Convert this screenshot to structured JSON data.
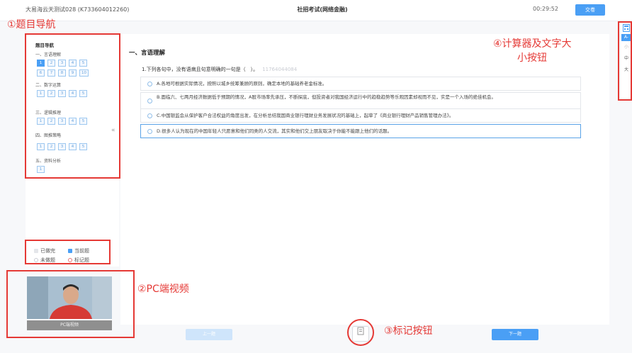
{
  "header": {
    "candidate": "大易海云天测试028 (K733604012260)",
    "exam_title": "社招考试(网络金融)",
    "timer": "00:29:52",
    "submit_label": "交卷"
  },
  "annotations": {
    "nav": "①题目导航",
    "video": "②PC端视频",
    "mark": "③标记按钮",
    "tools_line1": "④计算器及文字大",
    "tools_line2": "小按钮"
  },
  "nav": {
    "title": "题目导航",
    "sections": [
      {
        "title": "一、言语理解",
        "numbers": [
          "1",
          "2",
          "3",
          "4",
          "5",
          "6",
          "7",
          "8",
          "9",
          "10"
        ]
      },
      {
        "title": "二、数字运算",
        "numbers": [
          "1",
          "2",
          "3",
          "4",
          "5"
        ]
      },
      {
        "title": "三、逻辑推理",
        "numbers": [
          "1",
          "2",
          "3",
          "4",
          "5"
        ]
      },
      {
        "title": "四、图推策略",
        "numbers": [
          "1",
          "2",
          "3",
          "4",
          "5"
        ]
      },
      {
        "title": "五、资料分析",
        "numbers": [
          "1"
        ]
      }
    ],
    "collapse": "«"
  },
  "legend": {
    "done": "已做完",
    "current": "当前题",
    "undone": "未做题",
    "marked": "标记题"
  },
  "video": {
    "caption": "PC端视频"
  },
  "question": {
    "section": "一、言语理解",
    "text": "1.下列各句中，没有语病且句意明确的一句是（　）。",
    "id": "11764044084",
    "options": [
      "A.各地可根据实际情况，按照以城乡统筹兼顾的原则，确定本地的基础养老金标准。",
      "B.面临六、七两月经济数据低于预期的情况，A股市场率先承压，不断探底，但投资者对我国经济运行中的趋稳趋势等乐观因素却视而不见，实是一个入场的绝佳机会。",
      "C.中国银监会从保护客户合法权益的角度出发，在分析总结我国商业银行理财业务发展状况的基础上，起草了《商业银行理财产品销售管理办法》。",
      "D.很多人认为现在的中国年轻人只愿意和他们同类的人交流，其实和他们交上朋友取决于你能不能跟上他们的话题。"
    ]
  },
  "footer": {
    "prev": "上一题",
    "next": "下一题",
    "mark_icon": "bookmark-icon"
  },
  "tools": {
    "calc_icon": "calculator-icon",
    "font_a": "A-",
    "small": "小",
    "medium": "中",
    "large": "大"
  },
  "colors": {
    "accent": "#4a9ff5",
    "annotation": "#e53935"
  }
}
